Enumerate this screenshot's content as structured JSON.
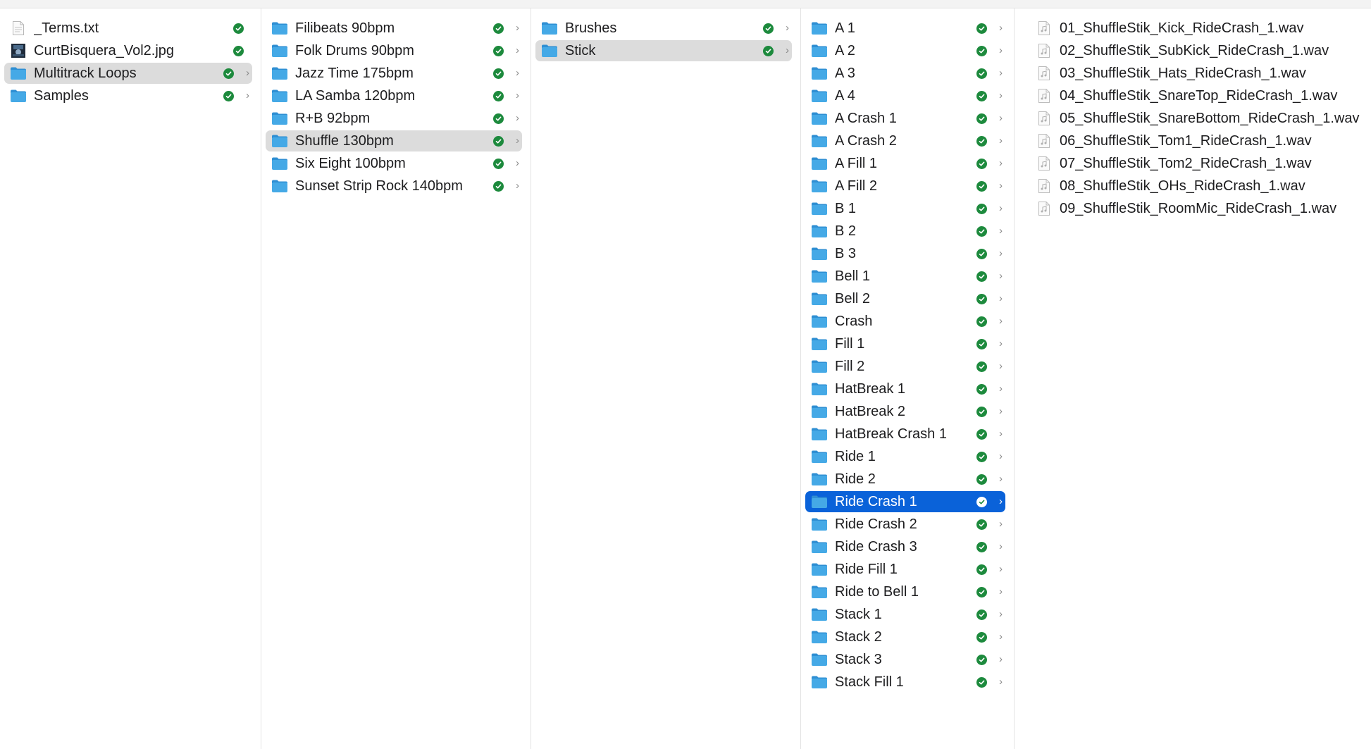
{
  "columns": [
    {
      "name": "root",
      "items": [
        {
          "label": "_Terms.txt",
          "icon": "text-file-icon",
          "status": "synced-check-icon"
        },
        {
          "label": "CurtBisquera_Vol2.jpg",
          "icon": "image-file-icon",
          "status": "synced-check-icon"
        },
        {
          "label": "Multitrack Loops",
          "icon": "folder-icon",
          "status": "synced-check-icon",
          "chevron": "›",
          "state": "highlighted"
        },
        {
          "label": "Samples",
          "icon": "folder-icon",
          "status": "synced-check-icon",
          "chevron": "›"
        }
      ]
    },
    {
      "name": "multitrack-loops",
      "items": [
        {
          "label": "Filibeats 90bpm",
          "icon": "folder-icon",
          "status": "synced-check-icon",
          "chevron": "›"
        },
        {
          "label": "Folk Drums 90bpm",
          "icon": "folder-icon",
          "status": "synced-check-icon",
          "chevron": "›"
        },
        {
          "label": "Jazz Time 175bpm",
          "icon": "folder-icon",
          "status": "synced-check-icon",
          "chevron": "›"
        },
        {
          "label": "LA Samba 120bpm",
          "icon": "folder-icon",
          "status": "synced-check-icon",
          "chevron": "›"
        },
        {
          "label": "R+B 92bpm",
          "icon": "folder-icon",
          "status": "synced-check-icon",
          "chevron": "›"
        },
        {
          "label": "Shuffle 130bpm",
          "icon": "folder-icon",
          "status": "synced-check-icon",
          "chevron": "›",
          "state": "highlighted"
        },
        {
          "label": "Six Eight 100bpm",
          "icon": "folder-icon",
          "status": "synced-check-icon",
          "chevron": "›"
        },
        {
          "label": "Sunset Strip Rock 140bpm",
          "icon": "folder-icon",
          "status": "synced-check-icon",
          "chevron": "›"
        }
      ]
    },
    {
      "name": "shuffle-130bpm",
      "items": [
        {
          "label": "Brushes",
          "icon": "folder-icon",
          "status": "synced-check-icon",
          "chevron": "›"
        },
        {
          "label": "Stick",
          "icon": "folder-icon",
          "status": "synced-check-icon",
          "chevron": "›",
          "state": "highlighted"
        }
      ]
    },
    {
      "name": "stick",
      "items": [
        {
          "label": "A 1",
          "icon": "folder-icon",
          "status": "synced-check-icon",
          "chevron": "›"
        },
        {
          "label": "A 2",
          "icon": "folder-icon",
          "status": "synced-check-icon",
          "chevron": "›"
        },
        {
          "label": "A 3",
          "icon": "folder-icon",
          "status": "synced-check-icon",
          "chevron": "›"
        },
        {
          "label": "A 4",
          "icon": "folder-icon",
          "status": "synced-check-icon",
          "chevron": "›"
        },
        {
          "label": "A Crash 1",
          "icon": "folder-icon",
          "status": "synced-check-icon",
          "chevron": "›"
        },
        {
          "label": "A Crash 2",
          "icon": "folder-icon",
          "status": "synced-check-icon",
          "chevron": "›"
        },
        {
          "label": "A Fill 1",
          "icon": "folder-icon",
          "status": "synced-check-icon",
          "chevron": "›"
        },
        {
          "label": "A Fill 2",
          "icon": "folder-icon",
          "status": "synced-check-icon",
          "chevron": "›"
        },
        {
          "label": "B 1",
          "icon": "folder-icon",
          "status": "synced-check-icon",
          "chevron": "›"
        },
        {
          "label": "B 2",
          "icon": "folder-icon",
          "status": "synced-check-icon",
          "chevron": "›"
        },
        {
          "label": "B 3",
          "icon": "folder-icon",
          "status": "synced-check-icon",
          "chevron": "›"
        },
        {
          "label": "Bell 1",
          "icon": "folder-icon",
          "status": "synced-check-icon",
          "chevron": "›"
        },
        {
          "label": "Bell 2",
          "icon": "folder-icon",
          "status": "synced-check-icon",
          "chevron": "›"
        },
        {
          "label": "Crash",
          "icon": "folder-icon",
          "status": "synced-check-icon",
          "chevron": "›"
        },
        {
          "label": "Fill 1",
          "icon": "folder-icon",
          "status": "synced-check-icon",
          "chevron": "›"
        },
        {
          "label": "Fill 2",
          "icon": "folder-icon",
          "status": "synced-check-icon",
          "chevron": "›"
        },
        {
          "label": "HatBreak 1",
          "icon": "folder-icon",
          "status": "synced-check-icon",
          "chevron": "›"
        },
        {
          "label": "HatBreak 2",
          "icon": "folder-icon",
          "status": "synced-check-icon",
          "chevron": "›"
        },
        {
          "label": "HatBreak Crash 1",
          "icon": "folder-icon",
          "status": "synced-check-icon",
          "chevron": "›"
        },
        {
          "label": "Ride 1",
          "icon": "folder-icon",
          "status": "synced-check-icon",
          "chevron": "›"
        },
        {
          "label": "Ride 2",
          "icon": "folder-icon",
          "status": "synced-check-icon",
          "chevron": "›"
        },
        {
          "label": "Ride Crash 1",
          "icon": "folder-icon",
          "status": "synced-check-icon",
          "chevron": "›",
          "state": "selected"
        },
        {
          "label": "Ride Crash 2",
          "icon": "folder-icon",
          "status": "synced-check-icon",
          "chevron": "›"
        },
        {
          "label": "Ride Crash 3",
          "icon": "folder-icon",
          "status": "synced-check-icon",
          "chevron": "›"
        },
        {
          "label": "Ride Fill 1",
          "icon": "folder-icon",
          "status": "synced-check-icon",
          "chevron": "›"
        },
        {
          "label": "Ride to Bell 1",
          "icon": "folder-icon",
          "status": "synced-check-icon",
          "chevron": "›"
        },
        {
          "label": "Stack 1",
          "icon": "folder-icon",
          "status": "synced-check-icon",
          "chevron": "›"
        },
        {
          "label": "Stack 2",
          "icon": "folder-icon",
          "status": "synced-check-icon",
          "chevron": "›"
        },
        {
          "label": "Stack 3",
          "icon": "folder-icon",
          "status": "synced-check-icon",
          "chevron": "›"
        },
        {
          "label": "Stack Fill 1",
          "icon": "folder-icon",
          "status": "synced-check-icon",
          "chevron": "›"
        }
      ]
    },
    {
      "name": "ride-crash-1",
      "items": [
        {
          "label": "01_ShuffleStik_Kick_RideCrash_1.wav",
          "icon": "audio-file-icon"
        },
        {
          "label": "02_ShuffleStik_SubKick_RideCrash_1.wav",
          "icon": "audio-file-icon"
        },
        {
          "label": "03_ShuffleStik_Hats_RideCrash_1.wav",
          "icon": "audio-file-icon"
        },
        {
          "label": "04_ShuffleStik_SnareTop_RideCrash_1.wav",
          "icon": "audio-file-icon"
        },
        {
          "label": "05_ShuffleStik_SnareBottom_RideCrash_1.wav",
          "icon": "audio-file-icon"
        },
        {
          "label": "06_ShuffleStik_Tom1_RideCrash_1.wav",
          "icon": "audio-file-icon"
        },
        {
          "label": "07_ShuffleStik_Tom2_RideCrash_1.wav",
          "icon": "audio-file-icon"
        },
        {
          "label": "08_ShuffleStik_OHs_RideCrash_1.wav",
          "icon": "audio-file-icon"
        },
        {
          "label": "09_ShuffleStik_RoomMic_RideCrash_1.wav",
          "icon": "audio-file-icon"
        }
      ]
    }
  ],
  "colors": {
    "folder": "#45a9e6",
    "folder_dark": "#2f8fd3",
    "selection": "#0a62d9",
    "highlight": "#dcdcdc",
    "status_check": "#1d8a3d"
  }
}
